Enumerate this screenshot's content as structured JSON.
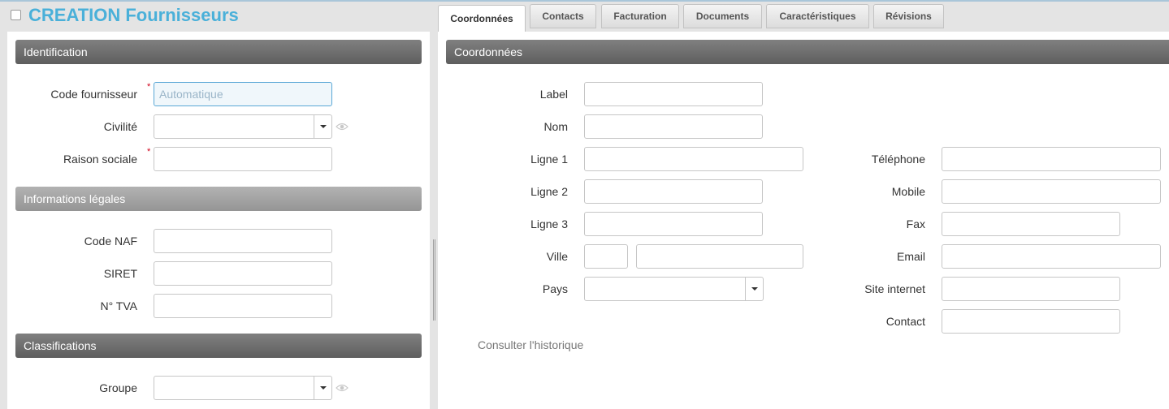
{
  "header": {
    "title": "CREATION Fournisseurs"
  },
  "tabs": [
    {
      "label": "Coordonnées",
      "active": true
    },
    {
      "label": "Contacts"
    },
    {
      "label": "Facturation"
    },
    {
      "label": "Documents"
    },
    {
      "label": "Caractéristiques"
    },
    {
      "label": "Révisions"
    }
  ],
  "left": {
    "identification": {
      "title": "Identification",
      "code_fournisseur": {
        "label": "Code fournisseur",
        "placeholder": "Automatique",
        "value": ""
      },
      "civilite": {
        "label": "Civilité",
        "value": ""
      },
      "raison_sociale": {
        "label": "Raison sociale",
        "value": ""
      }
    },
    "legal": {
      "title": "Informations légales",
      "code_naf": {
        "label": "Code NAF",
        "value": ""
      },
      "siret": {
        "label": "SIRET",
        "value": ""
      },
      "tva": {
        "label": "N° TVA",
        "value": ""
      }
    },
    "classifications": {
      "title": "Classifications",
      "groupe": {
        "label": "Groupe",
        "value": ""
      }
    },
    "required_mark": "*"
  },
  "right": {
    "title": "Coordonnées",
    "label": {
      "label": "Label",
      "value": ""
    },
    "nom": {
      "label": "Nom",
      "value": ""
    },
    "ligne1": {
      "label": "Ligne 1",
      "value": ""
    },
    "ligne2": {
      "label": "Ligne 2",
      "value": ""
    },
    "ligne3": {
      "label": "Ligne 3",
      "value": ""
    },
    "ville": {
      "label": "Ville",
      "postal_value": "",
      "city_value": ""
    },
    "pays": {
      "label": "Pays",
      "value": ""
    },
    "telephone": {
      "label": "Téléphone",
      "value": ""
    },
    "mobile": {
      "label": "Mobile",
      "value": ""
    },
    "fax": {
      "label": "Fax",
      "value": ""
    },
    "email": {
      "label": "Email",
      "value": ""
    },
    "site": {
      "label": "Site internet",
      "value": ""
    },
    "contact": {
      "label": "Contact",
      "value": ""
    },
    "history_link": "Consulter l'historique"
  },
  "colors": {
    "title": "#4ab0d9",
    "required": "#d0021b",
    "section": "#6e6e6e",
    "section_light": "#a3a3a3"
  },
  "icons": {
    "visibility": "eye-icon",
    "dropdown": "chevron-down-icon"
  }
}
